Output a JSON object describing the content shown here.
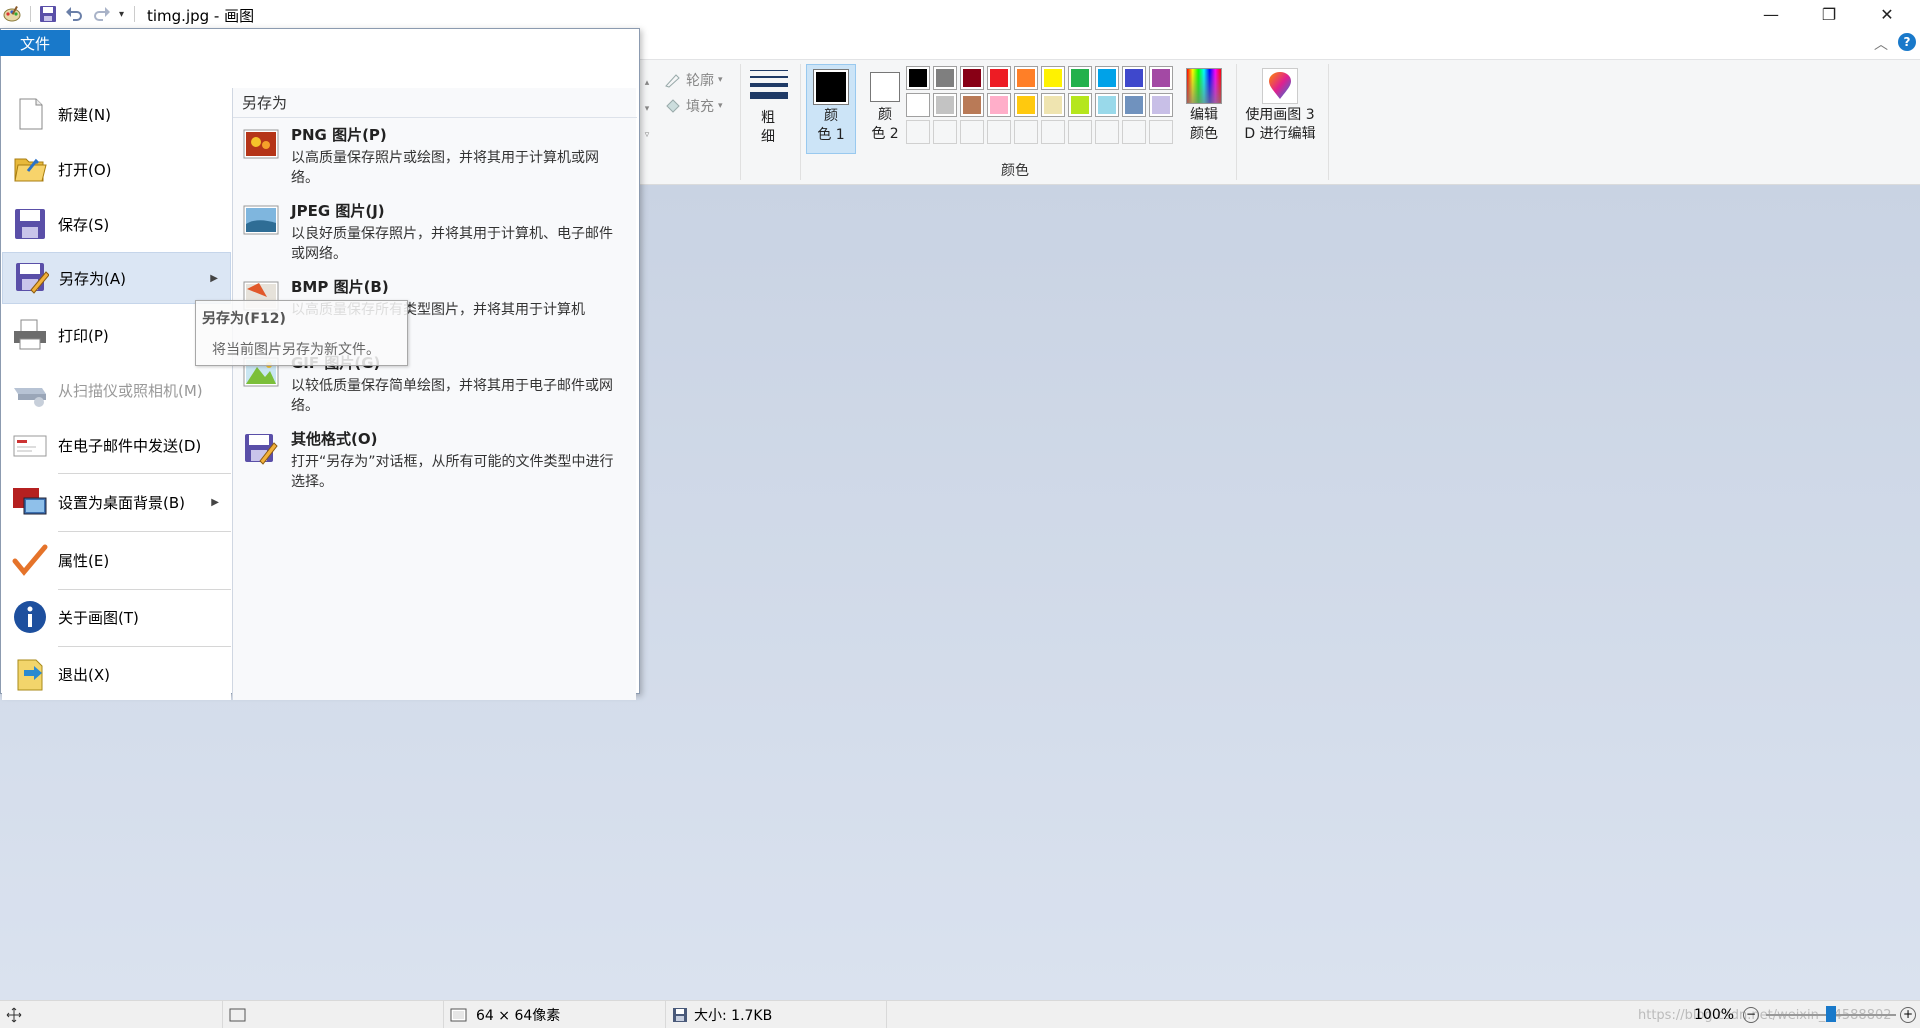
{
  "window": {
    "title": "timg.jpg - 画图",
    "minimize": "—",
    "restore": "❐",
    "close": "✕"
  },
  "ribbon": {
    "file_tab": "文件",
    "outline": "轮廓",
    "fill": "填充",
    "size": "粗\n细",
    "color1": "颜\n色 1",
    "color2": "颜\n色 2",
    "edit_colors": "编辑\n颜色",
    "paint3d": "使用画图 3\nD 进行编辑",
    "colors_group": "颜色",
    "palette": [
      "#000000",
      "#7f7f7f",
      "#880015",
      "#ed1c24",
      "#ff7f27",
      "#fff200",
      "#22b14c",
      "#00a2e8",
      "#3f48cc",
      "#a349a4",
      "#ffffff",
      "#c3c3c3",
      "#b97a57",
      "#ffaec9",
      "#ffc90e",
      "#efe4b0",
      "#b5e61d",
      "#99d9ea",
      "#7092be",
      "#c8bfe7"
    ]
  },
  "file_menu": {
    "items": [
      {
        "label": "新建(N)",
        "icon": "new-file-icon"
      },
      {
        "label": "打开(O)",
        "icon": "open-folder-icon"
      },
      {
        "label": "保存(S)",
        "icon": "save-icon"
      },
      {
        "label": "另存为(A)",
        "icon": "save-as-icon"
      },
      {
        "label": "打印(P)",
        "icon": "printer-icon"
      },
      {
        "label": "从扫描仪或照相机(M)",
        "icon": "scanner-icon"
      },
      {
        "label": "在电子邮件中发送(D)",
        "icon": "email-icon"
      },
      {
        "label": "设置为桌面背景(B)",
        "icon": "desktop-background-icon"
      },
      {
        "label": "属性(E)",
        "icon": "checkmark-icon"
      },
      {
        "label": "关于画图(T)",
        "icon": "info-icon"
      },
      {
        "label": "退出(X)",
        "icon": "exit-icon"
      }
    ],
    "submenu_title": "另存为",
    "formats": [
      {
        "name": "PNG 图片(P)",
        "desc": "以高质量保存照片或绘图，并将其用于计算机或网络。"
      },
      {
        "name": "JPEG 图片(J)",
        "desc": "以良好质量保存照片，并将其用于计算机、电子邮件或网络。"
      },
      {
        "name": "BMP 图片(B)",
        "desc": "以高质量保存所有类型图片，并将其用于计算机"
      },
      {
        "name": "GIF 图片(G)",
        "desc": "以较低质量保存简单绘图，并将其用于电子邮件或网络。"
      },
      {
        "name": "其他格式(O)",
        "desc": "打开“另存为”对话框，从所有可能的文件类型中进行选择。"
      }
    ]
  },
  "tooltip": {
    "title": "另存为(F12)",
    "text": "将当前图片另存为新文件。"
  },
  "status": {
    "dimensions": "64 × 64像素",
    "size": "大小: 1.7KB",
    "zoom": "100%",
    "watermark": "https://blog.csdn.net/weixin_44588802"
  }
}
